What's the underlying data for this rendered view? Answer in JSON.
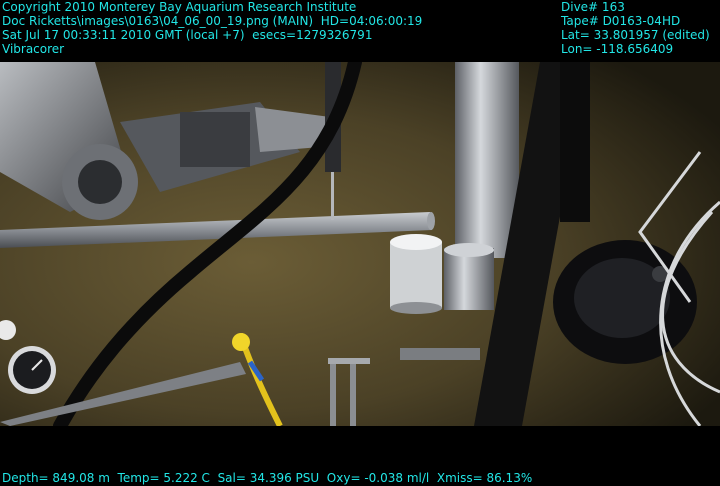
{
  "overlay": {
    "top_left": [
      "Copyright 2010 Monterey Bay Aquarium Research Institute",
      "Doc Ricketts\\images\\0163\\04_06_00_19.png (MAIN)  HD=04:06:00:19",
      "Sat Jul 17 00:33:11 2010 GMT (local +7)  esecs=1279326791",
      "Vibracorer"
    ],
    "top_right": [
      "Dive# 163",
      "Tape# D0163-04HD",
      "Lat= 33.801957 (edited)",
      "Lon= -118.656409"
    ],
    "bottom": "Depth= 849.08 m  Temp= 5.222 C  Sal= 34.396 PSU  Oxy= -0.038 ml/l  Xmiss= 86.13%"
  },
  "colors": {
    "overlay_text": "#22e6e6",
    "seafloor": "#5a4e2c",
    "letterbox": "#000000"
  }
}
